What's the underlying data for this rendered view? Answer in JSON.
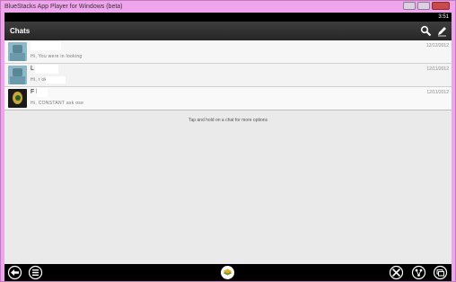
{
  "window": {
    "title": "BlueStacks App Player for Windows (beta)"
  },
  "status_bar": {
    "time": "3:51"
  },
  "action_bar": {
    "title": "Chats",
    "search_icon": "search-icon",
    "compose_icon": "compose-icon"
  },
  "chats": [
    {
      "name": "",
      "preview": "Hi,  You were   in  looking",
      "date": "12/12/2012",
      "avatar": "default"
    },
    {
      "name": "L        t",
      "preview": "Hi,   r        ok   ose",
      "date": "12/11/2012",
      "avatar": "default"
    },
    {
      "name": "F       ly",
      "preview": "Hi,   CONSTANT   ask   ose",
      "date": "12/11/2012",
      "avatar": "photo"
    }
  ],
  "hint": "Tap and hold on a chat for more options",
  "nav_bar": {
    "icons": [
      "back-icon",
      "menu-icon",
      "bluestacks-home-icon",
      "settings-tools-icon",
      "share-icon",
      "recent-apps-icon"
    ]
  }
}
